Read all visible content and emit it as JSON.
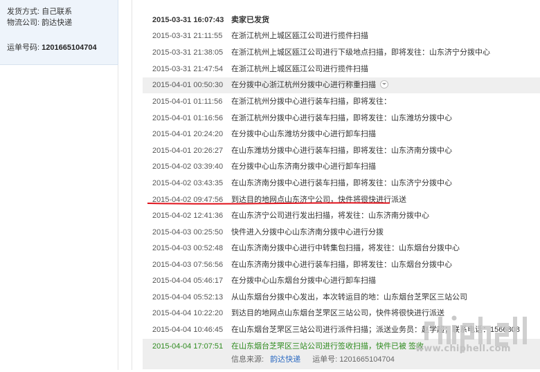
{
  "shipping_info": {
    "method_label": "发货方式:",
    "method_value": "自己联系",
    "company_label": "物流公司:",
    "company_value": "韵达快递",
    "tracking_label": "运单号码:",
    "tracking_value": "1201665104704"
  },
  "events": [
    {
      "time": "2015-03-31 16:07:43",
      "desc": "卖家已发货"
    },
    {
      "time": "2015-03-31 21:11:55",
      "desc": "在浙江杭州上城区瓯江公司进行揽件扫描"
    },
    {
      "time": "2015-03-31 21:38:05",
      "desc": "在浙江杭州上城区瓯江公司进行下级地点扫描，即将发往：山东济宁分拨中心"
    },
    {
      "time": "2015-03-31 21:47:54",
      "desc": "在浙江杭州上城区瓯江公司进行揽件扫描"
    },
    {
      "time": "2015-04-01 00:50:30",
      "desc": "在分拨中心浙江杭州分拨中心进行称重扫描"
    },
    {
      "time": "2015-04-01 01:11:56",
      "desc": "在浙江杭州分拨中心进行装车扫描，即将发往："
    },
    {
      "time": "2015-04-01 01:16:56",
      "desc": "在浙江杭州分拨中心进行装车扫描，即将发往：山东潍坊分拨中心"
    },
    {
      "time": "2015-04-01 20:24:20",
      "desc": "在分拨中心山东潍坊分拨中心进行卸车扫描"
    },
    {
      "time": "2015-04-01 20:26:27",
      "desc": "在山东潍坊分拨中心进行装车扫描，即将发往：山东济南分拨中心"
    },
    {
      "time": "2015-04-02 03:39:40",
      "desc": "在分拨中心山东济南分拨中心进行卸车扫描"
    },
    {
      "time": "2015-04-02 03:43:35",
      "desc": "在山东济南分拨中心进行装车扫描，即将发往：山东济宁分拨中心"
    },
    {
      "time": "2015-04-02 09:47:56",
      "desc": "到达目的地网点山东济宁公司，快件将很快进行派送"
    },
    {
      "time": "2015-04-02 12:41:36",
      "desc": "在山东济宁公司进行发出扫描，将发往：山东济南分拨中心"
    },
    {
      "time": "2015-04-03 00:25:50",
      "desc": "快件进入分拨中心山东济南分拨中心进行分拨"
    },
    {
      "time": "2015-04-03 00:52:48",
      "desc": "在山东济南分拨中心进行中转集包扫描，将发往：山东烟台分拨中心"
    },
    {
      "time": "2015-04-03 07:56:56",
      "desc": "在山东济南分拨中心进行装车扫描，即将发往：山东烟台分拨中心"
    },
    {
      "time": "2015-04-04 05:46:17",
      "desc": "在分拨中心山东烟台分拨中心进行卸车扫描"
    },
    {
      "time": "2015-04-04 05:52:13",
      "desc": "从山东烟台分拨中心发出，本次转运目的地：山东烟台芝罘区三站公司"
    },
    {
      "time": "2015-04-04 10:22:20",
      "desc": "到达目的地网点山东烟台芝罘区三站公司，快件将很快进行派送"
    },
    {
      "time": "2015-04-04 10:46:45",
      "desc": "在山东烟台芝罘区三站公司进行派件扫描；派送业务员：赵学超；联系电话：1566808"
    }
  ],
  "final_event": {
    "time": "2015-04-04 17:07:51",
    "desc": "在山东烟台芝罘区三站公司进行签收扫描，快件已被 签收",
    "source_label": "信息来源:",
    "source_link": "韵达快递",
    "tracking_label": "运单号:",
    "tracking_value": "1201665104704"
  },
  "watermark": {
    "logo_text": "chiphell",
    "url": "www.chiphell.com"
  },
  "colors": {
    "left_panel_bg": "#eef4fb",
    "final_green": "#2e8b1e",
    "link_blue": "#2d6bc2",
    "underline_red": "#e0101a"
  }
}
